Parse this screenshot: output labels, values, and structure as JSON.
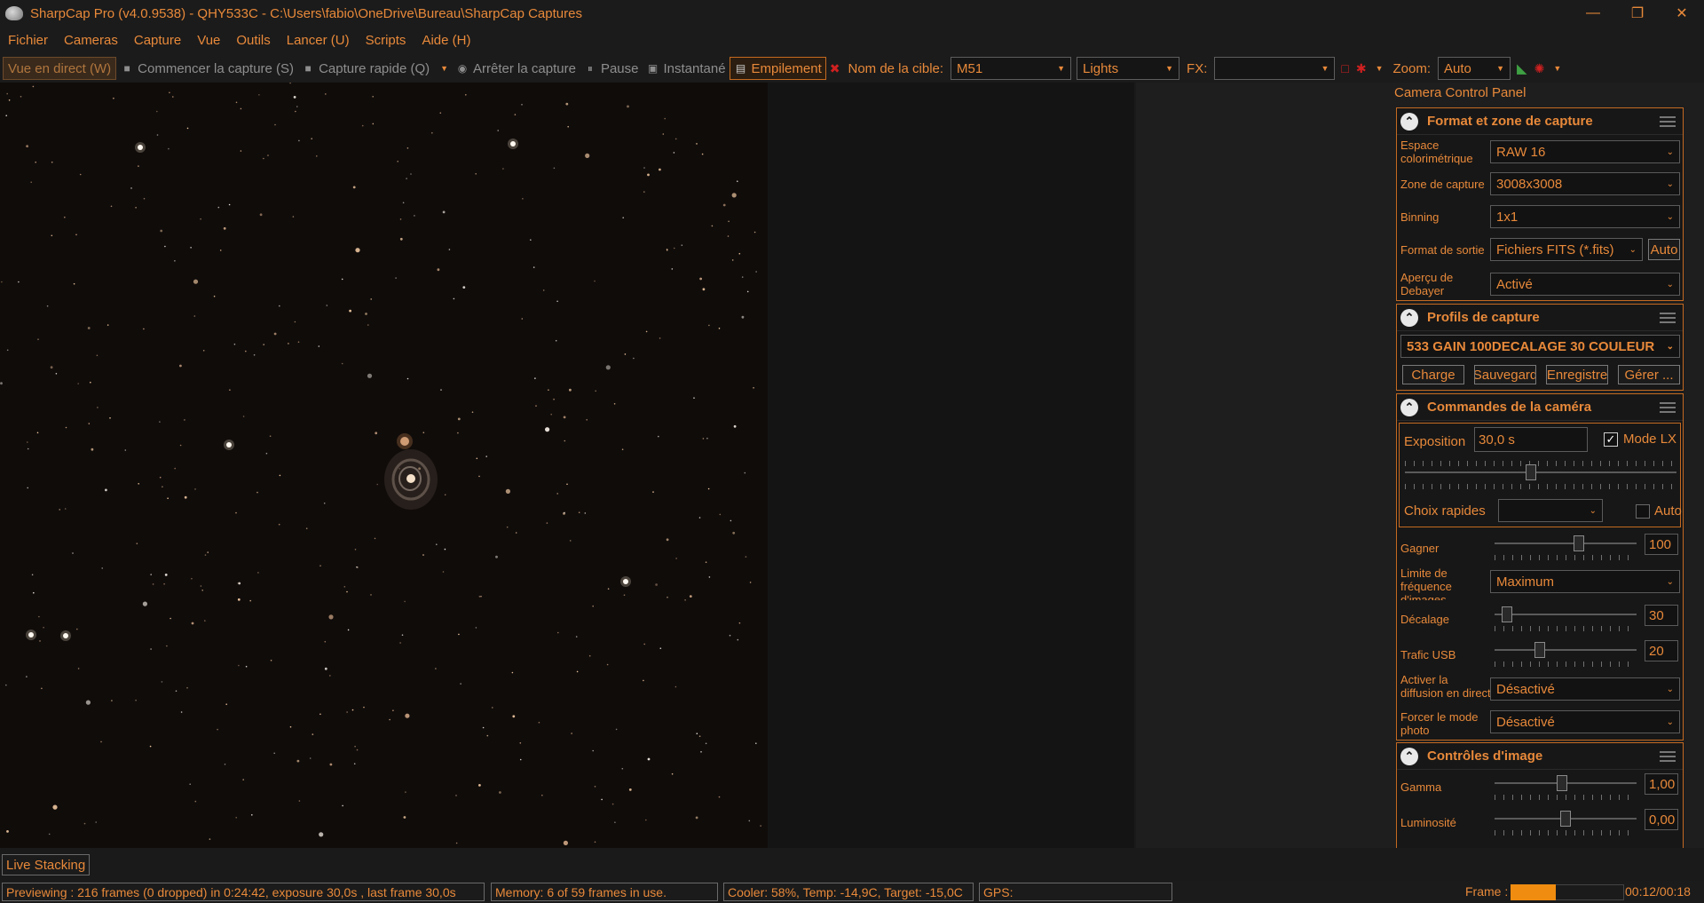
{
  "window": {
    "title": "SharpCap Pro (v4.0.9538) - QHY533C - C:\\Users\\fabio\\OneDrive\\Bureau\\SharpCap Captures",
    "minimize": "—",
    "maximize": "❐",
    "close": "✕"
  },
  "menu": [
    "Fichier",
    "Cameras",
    "Capture",
    "Vue",
    "Outils",
    "Lancer (U)",
    "Scripts",
    "Aide (H)"
  ],
  "toolbar": {
    "live_view": "Vue en direct (W)",
    "start_capture": "Commencer la capture (S)",
    "quick_capture": "Capture rapide (Q)",
    "stop_capture": "Arrêter la capture",
    "pause": "Pause",
    "snapshot": "Instantané",
    "stacking": "Empilement",
    "target_label": "Nom de la cible:",
    "target_value": "M51",
    "frame_type": "Lights",
    "fx_label": "FX:",
    "fx_value": "",
    "zoom_label": "Zoom:",
    "zoom_value": "Auto"
  },
  "panel": {
    "title": "Camera Control Panel",
    "format": {
      "title": "Format et zone de capture",
      "color_space_label": "Espace colorimétrique",
      "color_space_value": "RAW 16",
      "capture_area_label": "Zone de capture",
      "capture_area_value": "3008x3008",
      "binning_label": "Binning",
      "binning_value": "1x1",
      "output_format_label": "Format de sortie",
      "output_format_value": "Fichiers FITS (*.fits)",
      "output_auto": "Auto",
      "debayer_label": "Aperçu de Debayer",
      "debayer_value": "Activé"
    },
    "profiles": {
      "title": "Profils de capture",
      "selected": "533 GAIN 100DECALAGE 30 COULEUR",
      "load": "Charge",
      "save": "Sauvegard",
      "save_as": "Enregistre",
      "manage": "Gérer ..."
    },
    "camera": {
      "title": "Commandes de la caméra",
      "exposure_label": "Exposition",
      "exposure_value": "30,0 s",
      "lx_mode_label": "Mode LX",
      "quick_choice_label": "Choix rapides",
      "quick_choice_value": "",
      "auto_label": "Auto",
      "gain_label": "Gagner",
      "gain_value": "100",
      "frame_limit_label": "Limite de fréquence d'images",
      "frame_limit_value": "Maximum",
      "offset_label": "Décalage",
      "offset_value": "30",
      "usb_label": "Trafic USB",
      "usb_value": "20",
      "live_stream_label": "Activer la diffusion en direct",
      "live_stream_value": "Désactivé",
      "photo_mode_label": "Forcer le mode photo",
      "photo_mode_value": "Désactivé"
    },
    "image": {
      "title": "Contrôles d'image",
      "gamma_label": "Gamma",
      "gamma_value": "1,00",
      "brightness_label": "Luminosité",
      "brightness_value": "0,00"
    }
  },
  "bottom": {
    "tab": "Live Stacking"
  },
  "status": {
    "preview": "Previewing : 216 frames (0 dropped) in 0:24:42, exposure 30,0s , last frame 30,0s",
    "memory": "Memory: 6 of 59 frames in use.",
    "cooler": "Cooler: 58%, Temp: -14,9C, Target: -15,0C",
    "gps": "GPS:",
    "frame_label": "Frame :",
    "frame_progress": 0.4,
    "frame_time": "00:12/00:18"
  },
  "colors": {
    "accent": "#e8893a",
    "background": "#1a1a1a",
    "sky": "#100c0a",
    "progress": "#f08c10"
  }
}
